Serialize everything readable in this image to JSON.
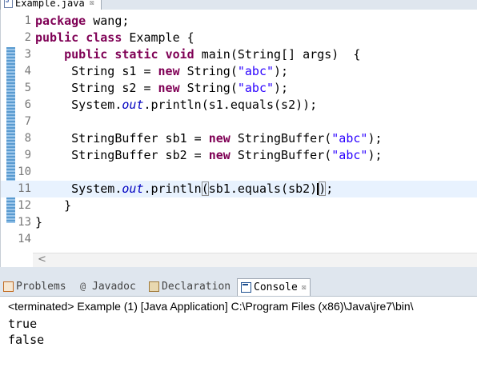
{
  "editor": {
    "tab_label": "Example.java",
    "tab_close": "☒",
    "lines": [
      {
        "num": "1",
        "parts": [
          {
            "t": "kw",
            "v": "package"
          },
          {
            "t": "n",
            "v": " wang;"
          }
        ]
      },
      {
        "num": "2",
        "parts": [
          {
            "t": "kw",
            "v": "public"
          },
          {
            "t": "n",
            "v": " "
          },
          {
            "t": "kw",
            "v": "class"
          },
          {
            "t": "n",
            "v": " Example {"
          }
        ]
      },
      {
        "num": "3",
        "parts": [
          {
            "t": "n",
            "v": "    "
          },
          {
            "t": "kw",
            "v": "public"
          },
          {
            "t": "n",
            "v": " "
          },
          {
            "t": "kw",
            "v": "static"
          },
          {
            "t": "n",
            "v": " "
          },
          {
            "t": "kw",
            "v": "void"
          },
          {
            "t": "n",
            "v": " main(String[] args)  {"
          }
        ]
      },
      {
        "num": "4",
        "parts": [
          {
            "t": "n",
            "v": "     String s1 = "
          },
          {
            "t": "kw",
            "v": "new"
          },
          {
            "t": "n",
            "v": " String("
          },
          {
            "t": "str",
            "v": "\"abc\""
          },
          {
            "t": "n",
            "v": ");"
          }
        ]
      },
      {
        "num": "5",
        "parts": [
          {
            "t": "n",
            "v": "     String s2 = "
          },
          {
            "t": "kw",
            "v": "new"
          },
          {
            "t": "n",
            "v": " String("
          },
          {
            "t": "str",
            "v": "\"abc\""
          },
          {
            "t": "n",
            "v": ");"
          }
        ]
      },
      {
        "num": "6",
        "parts": [
          {
            "t": "n",
            "v": "     System."
          },
          {
            "t": "fld",
            "v": "out"
          },
          {
            "t": "n",
            "v": ".println(s1.equals(s2));"
          }
        ]
      },
      {
        "num": "7",
        "parts": []
      },
      {
        "num": "8",
        "parts": [
          {
            "t": "n",
            "v": "     StringBuffer sb1 = "
          },
          {
            "t": "kw",
            "v": "new"
          },
          {
            "t": "n",
            "v": " StringBuffer("
          },
          {
            "t": "str",
            "v": "\"abc\""
          },
          {
            "t": "n",
            "v": ");"
          }
        ]
      },
      {
        "num": "9",
        "parts": [
          {
            "t": "n",
            "v": "     StringBuffer sb2 = "
          },
          {
            "t": "kw",
            "v": "new"
          },
          {
            "t": "n",
            "v": " StringBuffer("
          },
          {
            "t": "str",
            "v": "\"abc\""
          },
          {
            "t": "n",
            "v": ");"
          }
        ]
      },
      {
        "num": "10",
        "parts": []
      },
      {
        "num": "11",
        "current": true,
        "parts": [
          {
            "t": "n",
            "v": "     System."
          },
          {
            "t": "fld",
            "v": "out"
          },
          {
            "t": "n",
            "v": ".println"
          },
          {
            "t": "hb",
            "v": "("
          },
          {
            "t": "n",
            "v": "sb1.equals(sb2)"
          },
          {
            "t": "caret",
            "v": ""
          },
          {
            "t": "hb",
            "v": ")"
          },
          {
            "t": "n",
            "v": ";"
          }
        ]
      },
      {
        "num": "12",
        "parts": [
          {
            "t": "n",
            "v": "    }"
          }
        ]
      },
      {
        "num": "13",
        "parts": [
          {
            "t": "n",
            "v": "}"
          }
        ]
      },
      {
        "num": "14",
        "parts": []
      }
    ],
    "scroll_left": "<"
  },
  "views": {
    "tabs": [
      {
        "label": "Problems",
        "icon": "problems-icon"
      },
      {
        "label": "Javadoc",
        "icon": "javadoc-icon",
        "glyph": "@"
      },
      {
        "label": "Declaration",
        "icon": "declaration-icon"
      },
      {
        "label": "Console",
        "icon": "console-icon",
        "close": "☒",
        "active": true
      }
    ]
  },
  "console": {
    "header": "<terminated> Example (1) [Java Application] C:\\Program Files (x86)\\Java\\jre7\\bin\\",
    "output": [
      "true",
      "false"
    ]
  }
}
